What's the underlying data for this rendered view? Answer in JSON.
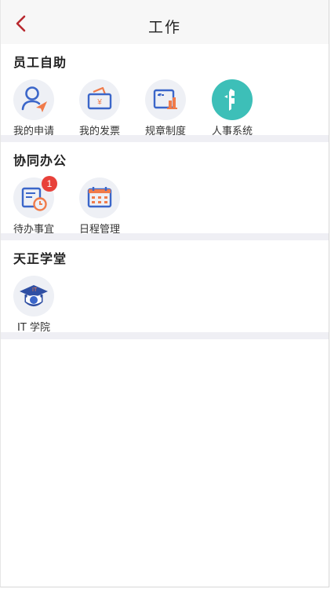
{
  "header": {
    "title": "工作",
    "back_icon": "chevron-left-icon"
  },
  "colors": {
    "accent_red": "#b8292f",
    "icon_blue": "#3b66c9",
    "icon_orange": "#f07b4a",
    "teal": "#3dbfb8",
    "badge_red": "#e8413a",
    "divider": "#efeff4"
  },
  "sections": [
    {
      "title": "员工自助",
      "items": [
        {
          "label": "我的申请",
          "icon": "application-send-icon"
        },
        {
          "label": "我的发票",
          "icon": "invoice-wallet-icon"
        },
        {
          "label": "规章制度",
          "icon": "regulations-chart-icon"
        },
        {
          "label": "人事系统",
          "icon": "hr-system-logo-icon"
        }
      ]
    },
    {
      "title": "协同办公",
      "items": [
        {
          "label": "待办事宜",
          "icon": "todo-clock-icon",
          "badge": "1"
        },
        {
          "label": "日程管理",
          "icon": "calendar-icon"
        }
      ]
    },
    {
      "title": "天正学堂",
      "items": [
        {
          "label": "IT 学院",
          "icon": "graduation-cap-icon",
          "cap_text": "IT"
        }
      ]
    }
  ]
}
